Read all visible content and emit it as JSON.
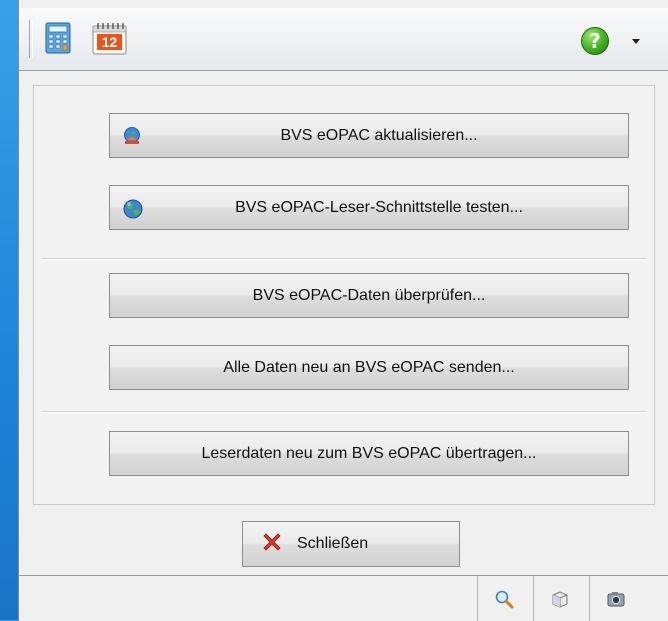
{
  "toolbar": {
    "icons": [
      "calculator-icon",
      "calendar-icon"
    ],
    "calendar_day": "12",
    "help_glyph": "?"
  },
  "actions": [
    {
      "label": "BVS eOPAC aktualisieren...",
      "icon": "update-globe-icon"
    },
    {
      "label": "BVS eOPAC-Leser-Schnittstelle testen...",
      "icon": "globe-icon"
    },
    {
      "label": "BVS eOPAC-Daten überprüfen..."
    },
    {
      "label": "Alle Daten neu an BVS eOPAC senden..."
    },
    {
      "label": "Leserdaten neu zum BVS eOPAC übertragen..."
    }
  ],
  "close_button": {
    "label": "Schließen",
    "icon": "close-x-icon"
  },
  "statusbar": {
    "icons": [
      "search-icon",
      "box-icon",
      "camera-icon"
    ]
  },
  "colors": {
    "background": "#1f86d9",
    "window": "#f0f0f0",
    "help_green": "#3fae1f",
    "close_red": "#e03a2a"
  }
}
